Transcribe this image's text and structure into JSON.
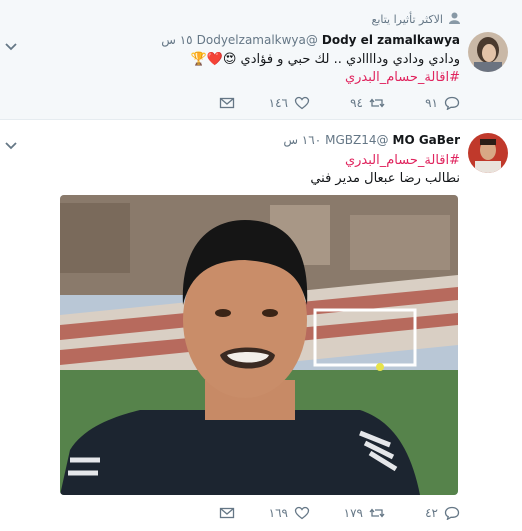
{
  "tweets": [
    {
      "social_context": "الاكثر تأثيرا يتابع",
      "name": "Dody el zamalkawya",
      "handle": "@Dodyelzamalkwya",
      "time": "١٥ س",
      "text_line1": "ودادي ودادي وداااادي .. لك حبي و فؤادي 😍❤️🏆",
      "hashtag": "#اقالة_حسام_البدري",
      "replies": "٩١",
      "retweets": "٩٤",
      "likes": "١٤٦"
    },
    {
      "name": "MO GaBer",
      "handle": "@MGBZ14",
      "time": "١٦٠ س",
      "hashtag": "#اقالة_حسام_البدري",
      "text_line2": "نطالب رضا عبعال مدير فني",
      "replies": "٤٢",
      "retweets": "١٧٩",
      "likes": "١٦٩"
    }
  ],
  "icons": {
    "person": "person-icon",
    "chevron": "chevron-down-icon",
    "reply": "reply-icon",
    "retweet": "retweet-icon",
    "like": "heart-icon",
    "dm": "envelope-icon"
  },
  "colors": {
    "hashtag": "#e0245e",
    "secondary_text": "#657786",
    "divider": "#e6ecf0"
  }
}
